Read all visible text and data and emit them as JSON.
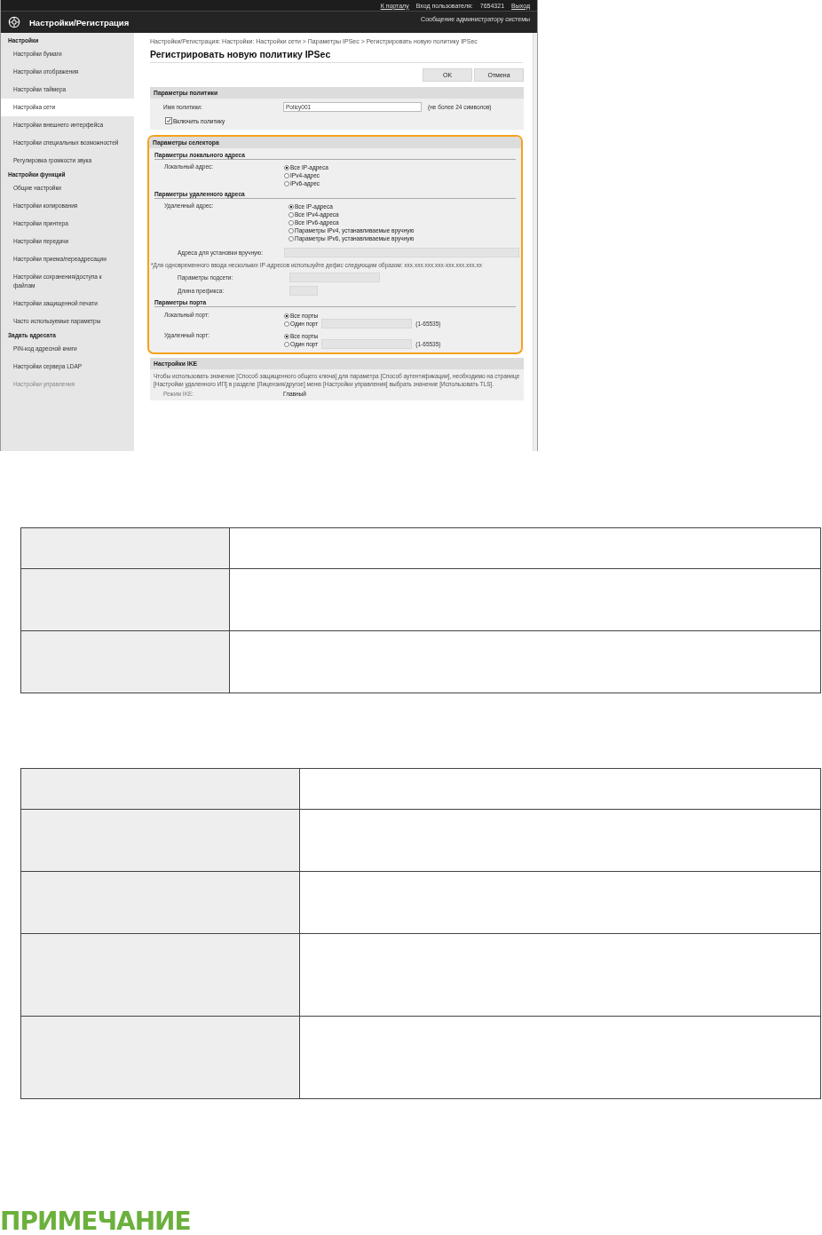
{
  "header": {
    "links": [
      {
        "text": "К порталу",
        "kind": "link"
      },
      {
        "text": "Вход пользователя:",
        "kind": "label"
      },
      {
        "text": "7654321",
        "kind": "label"
      },
      {
        "text": "Выход",
        "kind": "link"
      }
    ],
    "title": "Настройки/Регистрация",
    "admin_message": "Сообщение администратору системы"
  },
  "sidebar": [
    {
      "title": "Настройки",
      "items": [
        {
          "label": "Настройки бумаги",
          "selected": false
        },
        {
          "label": "Настройки отображения",
          "selected": false
        },
        {
          "label": "Настройки таймера",
          "selected": false
        },
        {
          "label": "Настройка сети",
          "selected": true
        },
        {
          "label": "Настройки внешнего интерфейса",
          "selected": false
        },
        {
          "label": "Настройки специальных возможностей",
          "selected": false
        },
        {
          "label": "Регулировка громкости звука",
          "selected": false
        }
      ]
    },
    {
      "title": "Настройки функций",
      "items": [
        {
          "label": "Общие настройки",
          "selected": false
        },
        {
          "label": "Настройки копирования",
          "selected": false
        },
        {
          "label": "Настройки принтера",
          "selected": false
        },
        {
          "label": "Настройки передачи",
          "selected": false
        },
        {
          "label": "Настройки приема/переадресации",
          "selected": false
        },
        {
          "label": "Настройки сохранения/доступа к файлам",
          "selected": false
        },
        {
          "label": "Настройки защищенной печати",
          "selected": false
        },
        {
          "label": "Часто используемые параметры",
          "selected": false
        }
      ]
    },
    {
      "title": "Задать адресата",
      "items": [
        {
          "label": "PIN-код адресной книги",
          "selected": false
        },
        {
          "label": "Настройки сервера LDAP",
          "selected": false
        },
        {
          "label": "Настройки управления",
          "selected": false
        }
      ]
    }
  ],
  "breadcrumb": "Настройки/Регистрация: Настройки: Настройки сети > Параметры IPSec > Регистрировать новую политику IPSec",
  "page_title": "Регистрировать новую политику IPSec",
  "buttons": [
    "OK",
    "Отмена"
  ],
  "policy": {
    "title": "Параметры политики",
    "name_label": "Имя политики:",
    "name_value": "Policy001",
    "name_hint": "(не более 24 символов)",
    "enable": {
      "label": "Включить политику",
      "checked": true
    }
  },
  "selector": {
    "title": "Параметры селектора",
    "local_heading": "Параметры локального адреса",
    "local_label": "Локальный адрес:",
    "local_options": [
      {
        "label": "Все IP-адреса",
        "selected": true
      },
      {
        "label": "IPv4-адрес",
        "selected": false
      },
      {
        "label": "IPv6-адрес",
        "selected": false
      }
    ],
    "remote_heading": "Параметры удаленного адреса",
    "remote_label": "Удаленный адрес:",
    "remote_options": [
      {
        "label": "Все IP-адреса",
        "selected": true
      },
      {
        "label": "Все IPv4-адреса",
        "selected": false
      },
      {
        "label": "Все IPv6-адреса",
        "selected": false
      },
      {
        "label": "Параметры IPv4, устанавливаемые вручную",
        "selected": false
      },
      {
        "label": "Параметры IPv6, устанавливаемые вручную",
        "selected": false
      }
    ],
    "manual_label": "Адреса для установки вручную:",
    "note": "*Для одновременного ввода нескольких IP-адресов используйте дефис следующим образом: xxx.xxx.xxx.xxx-xxx.xxx.xxx.xx",
    "subnet_label": "Параметры подсети:",
    "prefix_label": "Длина префикса:",
    "port_heading": "Параметры порта",
    "ports": [
      {
        "label": "Локальный порт:",
        "options": [
          {
            "label": "Все порты",
            "selected": true
          },
          {
            "label": "Один порт",
            "selected": false
          }
        ],
        "range": "(1-65535)"
      },
      {
        "label": "Удаленный порт:",
        "options": [
          {
            "label": "Все порты",
            "selected": true
          },
          {
            "label": "Один порт",
            "selected": false
          }
        ],
        "range": "(1-65535)"
      }
    ]
  },
  "ike": {
    "title": "Настройки IKE",
    "text": "Чтобы использовать значение [Способ защищенного общего ключа] для параметра [Способ аутентификации], необходимо на странице [Настройки удаленного ИП] в разделе [Лицензия/другое] меню [Настройки управления] выбрать значение [Использовать TLS].",
    "mode_label": "Режим IKE:",
    "mode_value": "Главный"
  },
  "tables": [
    {
      "rows": [
        {
          "kind": "short"
        },
        {
          "kind": "medium"
        },
        {
          "kind": "medium"
        }
      ]
    },
    {
      "rows": [
        {
          "kind": "short"
        },
        {
          "kind": "medium"
        },
        {
          "kind": "medium"
        },
        {
          "kind": "tall"
        },
        {
          "kind": "tall"
        }
      ]
    }
  ],
  "note_heading": "ПРИМЕЧАНИЕ"
}
